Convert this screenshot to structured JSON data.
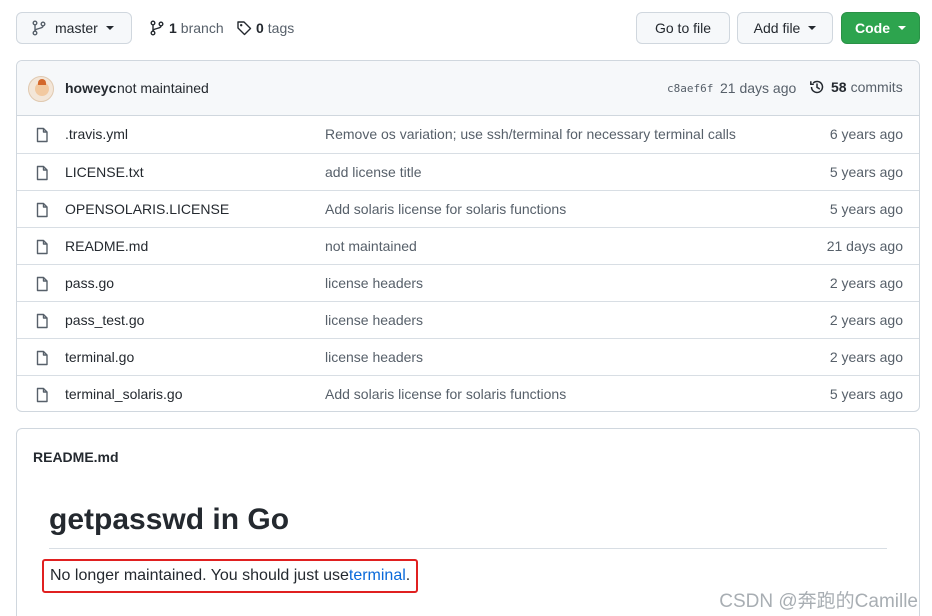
{
  "toolbar": {
    "branch_button": "master",
    "branches_count": "1",
    "branches_label": "branch",
    "tags_count": "0",
    "tags_label": "tags",
    "goto_file": "Go to file",
    "add_file": "Add file",
    "code": "Code"
  },
  "commit": {
    "author": "howeyc",
    "message": "not maintained",
    "sha": "c8aef6f",
    "age": "21 days ago",
    "count": "58",
    "count_label": "commits"
  },
  "files": [
    {
      "name": ".travis.yml",
      "message": "Remove os variation; use ssh/terminal for necessary terminal calls",
      "age": "6 years ago"
    },
    {
      "name": "LICENSE.txt",
      "message": "add license title",
      "age": "5 years ago"
    },
    {
      "name": "OPENSOLARIS.LICENSE",
      "message": "Add solaris license for solaris functions",
      "age": "5 years ago"
    },
    {
      "name": "README.md",
      "message": "not maintained",
      "age": "21 days ago"
    },
    {
      "name": "pass.go",
      "message": "license headers",
      "age": "2 years ago"
    },
    {
      "name": "pass_test.go",
      "message": "license headers",
      "age": "2 years ago"
    },
    {
      "name": "terminal.go",
      "message": "license headers",
      "age": "2 years ago"
    },
    {
      "name": "terminal_solaris.go",
      "message": "Add solaris license for solaris functions",
      "age": "5 years ago"
    }
  ],
  "readme": {
    "title": "README.md",
    "heading": "getpasswd in Go",
    "para_text": "No longer maintained. You should just use ",
    "para_link": "terminal",
    "para_end": "."
  },
  "watermark": "CSDN @奔跑的Camille",
  "colors": {
    "code_button": "#2da44e",
    "link": "#0969da",
    "highlight_box": "#e02020"
  }
}
